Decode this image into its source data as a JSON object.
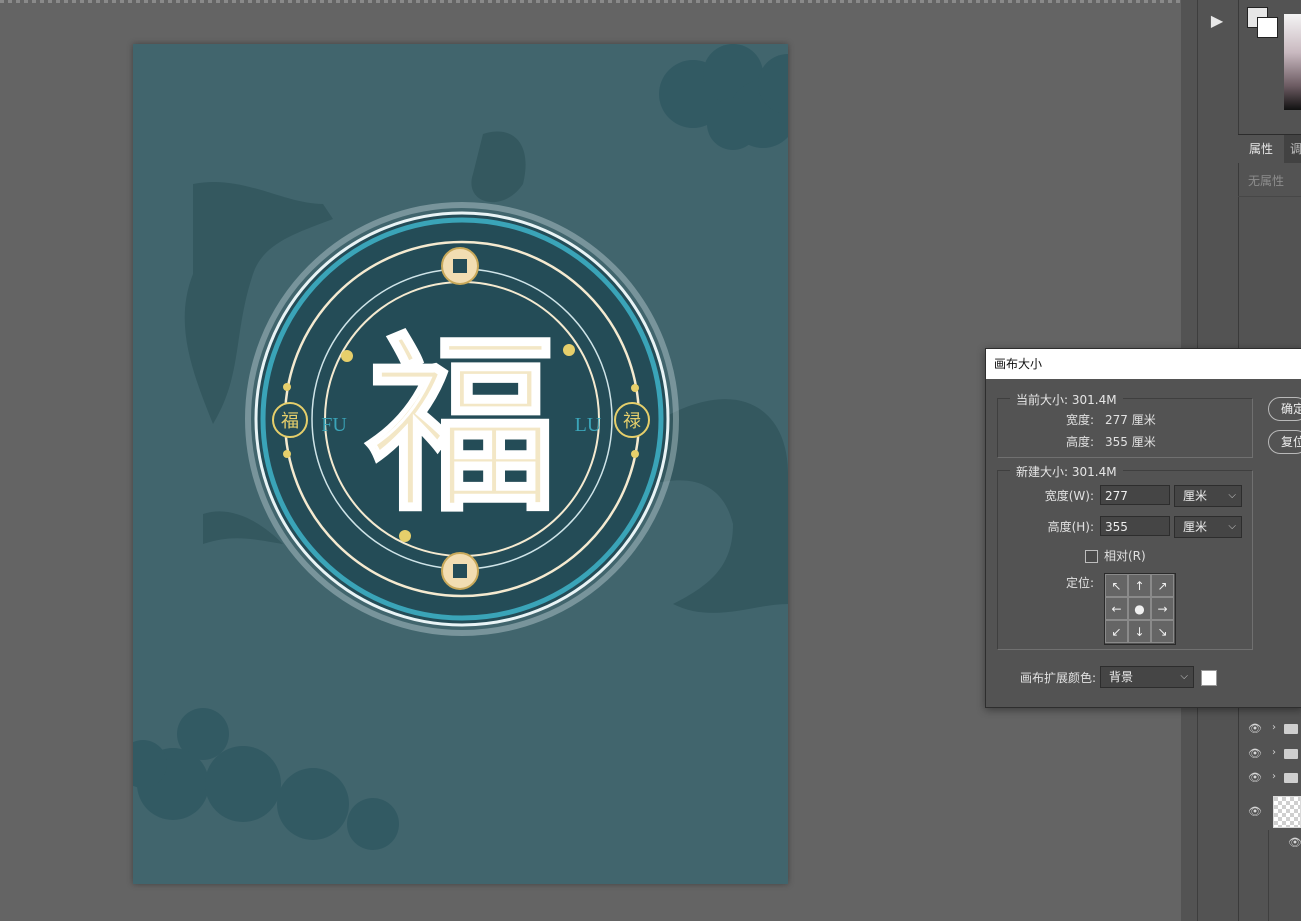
{
  "colors": {
    "workspace": "#646464",
    "canvas_bg": "#41656d",
    "medallion_dark": "#244c57",
    "ring_cyan": "#3aa4b8",
    "gold": "#e6cf6b",
    "cream": "#f5ead0"
  },
  "artwork": {
    "main_char": "福",
    "left_char": "福",
    "right_char": "禄",
    "left_text": "FU",
    "right_text": "LU"
  },
  "toolbar": {
    "play_icon": "▶"
  },
  "properties_panel": {
    "tab_active": "属性",
    "tab_second": "调",
    "empty_text": "无属性"
  },
  "dialog": {
    "title": "画布大小",
    "current": {
      "legend": "当前大小: 301.4M",
      "width_label": "宽度:",
      "width_value": "277 厘米",
      "height_label": "高度:",
      "height_value": "355 厘米"
    },
    "new_size": {
      "legend": "新建大小: 301.4M",
      "width_label": "宽度(W):",
      "width_value": "277",
      "width_unit": "厘米",
      "height_label": "高度(H):",
      "height_value": "355",
      "height_unit": "厘米",
      "relative_label": "相对(R)",
      "relative_checked": false,
      "anchor_label": "定位:",
      "anchor_arrows": [
        "↖",
        "↑",
        "↗",
        "←",
        "●",
        "→",
        "↙",
        "↓",
        "↘"
      ]
    },
    "extension_color_label": "画布扩展颜色:",
    "extension_color_value": "背景",
    "ok_label": "确定",
    "reset_label": "复位"
  }
}
